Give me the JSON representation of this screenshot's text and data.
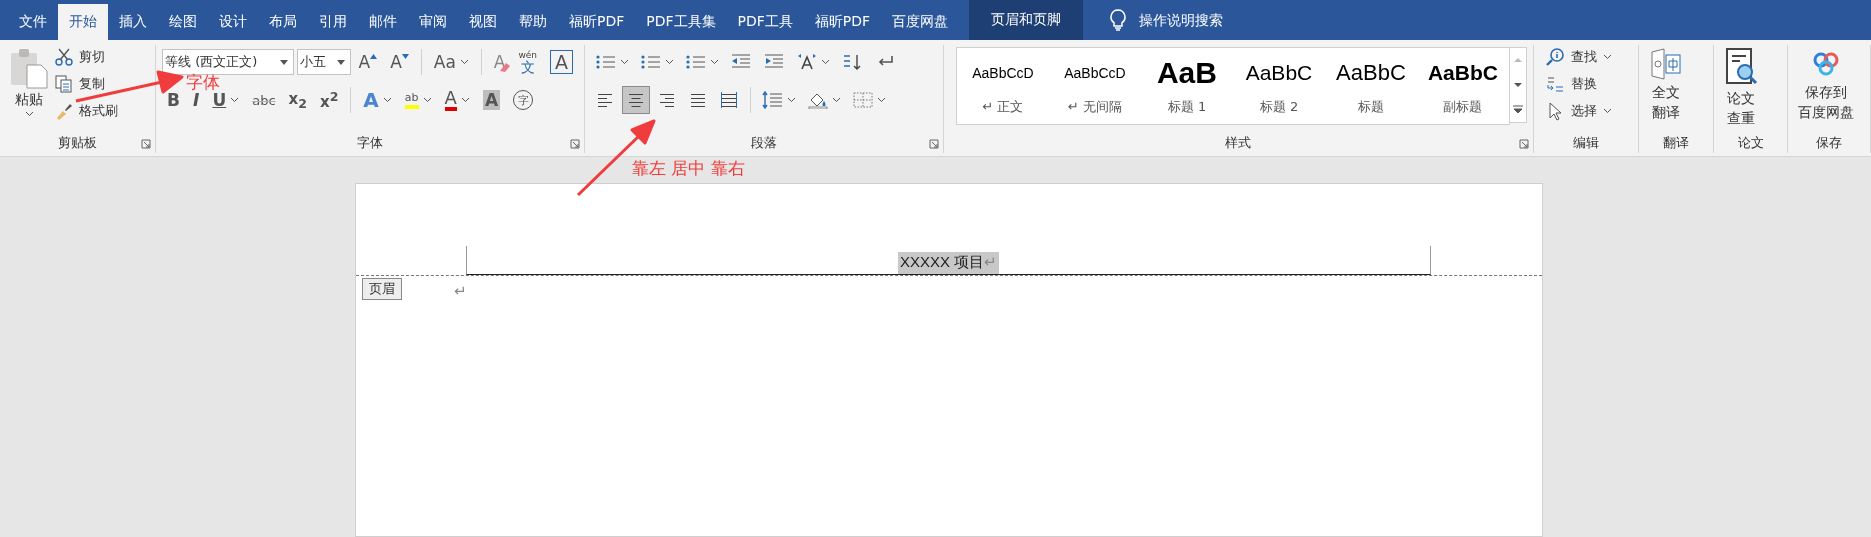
{
  "tabs": [
    {
      "label": "文件",
      "selected": false,
      "kind": "normal"
    },
    {
      "label": "开始",
      "selected": true,
      "kind": "normal"
    },
    {
      "label": "插入",
      "selected": false,
      "kind": "normal"
    },
    {
      "label": "绘图",
      "selected": false,
      "kind": "normal"
    },
    {
      "label": "设计",
      "selected": false,
      "kind": "normal"
    },
    {
      "label": "布局",
      "selected": false,
      "kind": "normal"
    },
    {
      "label": "引用",
      "selected": false,
      "kind": "normal"
    },
    {
      "label": "邮件",
      "selected": false,
      "kind": "normal"
    },
    {
      "label": "审阅",
      "selected": false,
      "kind": "normal"
    },
    {
      "label": "视图",
      "selected": false,
      "kind": "normal"
    },
    {
      "label": "帮助",
      "selected": false,
      "kind": "normal"
    },
    {
      "label": "福昕PDF",
      "selected": false,
      "kind": "normal"
    },
    {
      "label": "PDF工具集",
      "selected": false,
      "kind": "normal"
    },
    {
      "label": "PDF工具",
      "selected": false,
      "kind": "normal"
    },
    {
      "label": "福昕PDF",
      "selected": false,
      "kind": "normal"
    },
    {
      "label": "百度网盘",
      "selected": false,
      "kind": "normal"
    },
    {
      "label": "页眉和页脚",
      "selected": false,
      "kind": "contextual"
    }
  ],
  "search": {
    "placeholder": "操作说明搜索"
  },
  "clipboard": {
    "paste": "粘贴",
    "items": [
      {
        "label": "剪切",
        "kind": "cut"
      },
      {
        "label": "复制",
        "kind": "copy"
      },
      {
        "label": "格式刷",
        "kind": "brush"
      }
    ],
    "group": "剪贴板"
  },
  "font": {
    "font_name": "等线 (西文正文)",
    "font_size": "小五",
    "group": "字体",
    "row1": [
      {
        "kind": "grow",
        "text": "A"
      },
      {
        "kind": "shrink",
        "text": "A"
      },
      {
        "kind": "case",
        "text": "Aa"
      },
      {
        "kind": "clear",
        "text": "A"
      },
      {
        "kind": "phonetic",
        "text": "wén",
        "sub": "文"
      },
      {
        "kind": "border",
        "text": "A"
      }
    ],
    "row2": [
      {
        "kind": "bold",
        "text": "B"
      },
      {
        "kind": "italic",
        "text": "I"
      },
      {
        "kind": "underline",
        "text": "U"
      },
      {
        "kind": "strike",
        "text": "abc"
      },
      {
        "kind": "script",
        "text": "x$_{2}$"
      },
      {
        "kind": "script",
        "text": "x$^{2}$"
      },
      {
        "kind": "effects",
        "text": "A"
      },
      {
        "kind": "highlight",
        "text": "ab"
      },
      {
        "kind": "color",
        "text": "A"
      },
      {
        "kind": "shading",
        "text": "A"
      },
      {
        "kind": "enclose",
        "text": "字"
      }
    ]
  },
  "paragraph": {
    "group": "段落",
    "row1": [
      {
        "kind": "bullets"
      },
      {
        "kind": "numbering"
      },
      {
        "kind": "multilevel"
      },
      {
        "kind": "outdent"
      },
      {
        "kind": "indent"
      },
      {
        "kind": "direction"
      },
      {
        "kind": "sort"
      },
      {
        "kind": "marks"
      }
    ],
    "alignments": [
      {
        "kind": "left",
        "selected": false
      },
      {
        "kind": "center",
        "selected": true
      },
      {
        "kind": "right",
        "selected": false
      },
      {
        "kind": "justify",
        "selected": false
      },
      {
        "kind": "distribute",
        "selected": false
      }
    ],
    "row2": [
      {
        "kind": "spacing"
      },
      {
        "kind": "fill"
      },
      {
        "kind": "borders"
      }
    ]
  },
  "styles": {
    "group": "样式",
    "items": [
      {
        "sample": "AaBbCcD",
        "name": "↵ 正文",
        "kind": "normal"
      },
      {
        "sample": "AaBbCcD",
        "name": "↵ 无间隔",
        "kind": "normal"
      },
      {
        "sample": "AaB",
        "name": "标题 1",
        "kind": "heading1"
      },
      {
        "sample": "AaBbC",
        "name": "标题 2",
        "kind": "heading2"
      },
      {
        "sample": "AaBbC",
        "name": "标题",
        "kind": "title"
      },
      {
        "sample": "AaBbC",
        "name": "副标题",
        "kind": "subtitle"
      }
    ]
  },
  "editing": {
    "group": "编辑",
    "items": [
      {
        "label": "查找",
        "kind": "find",
        "dropdown": true
      },
      {
        "label": "替换",
        "kind": "replace",
        "dropdown": false
      },
      {
        "label": "选择",
        "kind": "select",
        "dropdown": true
      }
    ]
  },
  "big_groups": [
    {
      "kind": "translate",
      "lines": [
        "全文",
        "翻译"
      ],
      "group": "翻译"
    },
    {
      "kind": "thesis",
      "lines": [
        "论文",
        "查重"
      ],
      "group": "论文"
    },
    {
      "kind": "cloud",
      "lines": [
        "保存到",
        "百度网盘"
      ],
      "group": "保存"
    }
  ],
  "document": {
    "header_text": "XXXXX 项目",
    "header_mark": "↵",
    "header_label": "页眉",
    "body_mark": "↵"
  },
  "annotations": [
    {
      "text": "字体",
      "kind": "font"
    },
    {
      "text": "靠左 居中 靠右",
      "kind": "align"
    }
  ]
}
